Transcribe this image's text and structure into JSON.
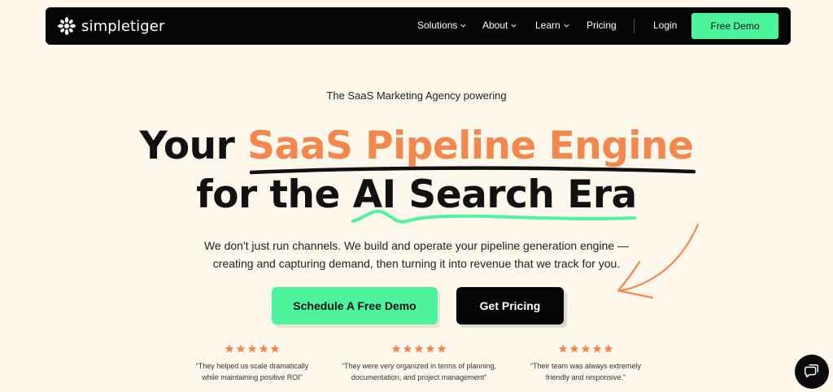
{
  "brand": {
    "name": "simpletiger"
  },
  "nav": {
    "items": [
      {
        "label": "Solutions",
        "has_dropdown": true
      },
      {
        "label": "About",
        "has_dropdown": true
      },
      {
        "label": "Learn",
        "has_dropdown": true
      },
      {
        "label": "Pricing",
        "has_dropdown": false
      }
    ],
    "login": "Login",
    "cta": "Free Demo"
  },
  "hero": {
    "eyebrow": "The SaaS Marketing Agency powering",
    "headline_prefix": "Your ",
    "headline_accent": "SaaS Pipeline Engine",
    "headline_line2": "for the AI Search Era",
    "subtext_line1": "We don't just run channels. We build and operate your pipeline generation engine —",
    "subtext_line2": "creating and capturing demand, then turning it into revenue that we track for you.",
    "primary_button": "Schedule A Free Demo",
    "secondary_button": "Get Pricing"
  },
  "testimonials": [
    {
      "rating": 5,
      "line1": "“They helped us scale dramatically",
      "line2": "while maintaining positive ROI”"
    },
    {
      "rating": 5,
      "line1": "“They were very organized in terms of planning,",
      "line2": "documentation, and project management”"
    },
    {
      "rating": 5,
      "line1": "“Their team was always extremely",
      "line2": "friendly and responsive.”"
    }
  ],
  "icons": {
    "chat": "chat-icon",
    "logo": "tiger-logo-icon",
    "dropdown": "chevron-down-icon",
    "star": "star-icon"
  },
  "colors": {
    "background": "#fdf7ec",
    "accent_orange": "#f4874b",
    "accent_green": "#4cf59d",
    "dark": "#050505"
  }
}
